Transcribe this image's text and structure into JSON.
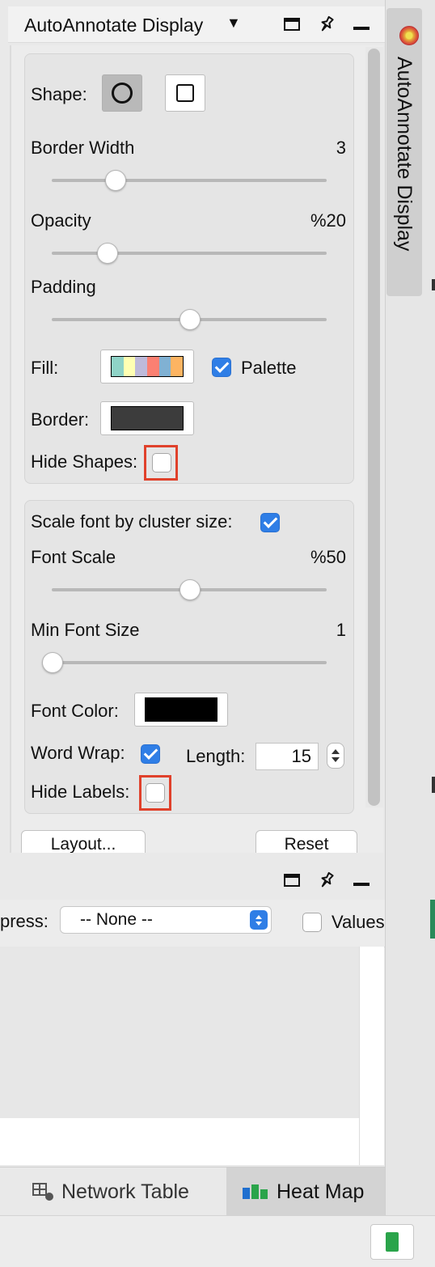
{
  "panel": {
    "title": "AutoAnnotate Display",
    "dropdown_arrow": "▼",
    "side_tab_label": "AutoAnnotate Display"
  },
  "shapes_group": {
    "shape_label": "Shape:",
    "shape_selected": "circle",
    "border_width": {
      "label": "Border Width",
      "value": "3",
      "slider_fraction": 0.23
    },
    "opacity": {
      "label": "Opacity",
      "value": "%20",
      "slider_fraction": 0.2
    },
    "padding": {
      "label": "Padding",
      "slider_fraction": 0.5
    },
    "fill_label": "Fill:",
    "fill_palette_colors": [
      "#8fd3c7",
      "#ffffb3",
      "#bebada",
      "#fb8072",
      "#80b1d3",
      "#fdb462"
    ],
    "palette_label": "Palette",
    "palette_checked": true,
    "border_label": "Border:",
    "border_color": "#3c3c3c",
    "hide_shapes_label": "Hide Shapes:",
    "hide_shapes_checked": false
  },
  "labels_group": {
    "scale_font_label": "Scale font by cluster size:",
    "scale_font_checked": true,
    "font_scale": {
      "label": "Font Scale",
      "value": "%50",
      "slider_fraction": 0.5
    },
    "min_font_size": {
      "label": "Min Font Size",
      "value": "1",
      "slider_fraction": 0.0
    },
    "font_color_label": "Font Color:",
    "font_color": "#000000",
    "word_wrap_label": "Word Wrap:",
    "word_wrap_checked": true,
    "length_label": "Length:",
    "length_value": "15",
    "hide_labels_label": "Hide Labels:",
    "hide_labels_checked": false
  },
  "buttons": {
    "layout": "Layout...",
    "reset": "Reset"
  },
  "lower_panel": {
    "express_label": "press:",
    "express_value": "-- None --",
    "values_label": "Values",
    "values_checked": false
  },
  "bottom_tabs": [
    {
      "label": "Network Table",
      "active": false
    },
    {
      "label": "Heat Map",
      "active": true
    }
  ],
  "colors": {
    "accent_blue": "#2f7ee6",
    "highlight_red": "#e0412b",
    "status_green": "#2aa44a"
  },
  "icons": [
    "maximize-icon",
    "pin-icon",
    "minimize-icon",
    "autoannotate-icon",
    "network-table-icon",
    "heat-map-icon",
    "memory-status-icon"
  ]
}
